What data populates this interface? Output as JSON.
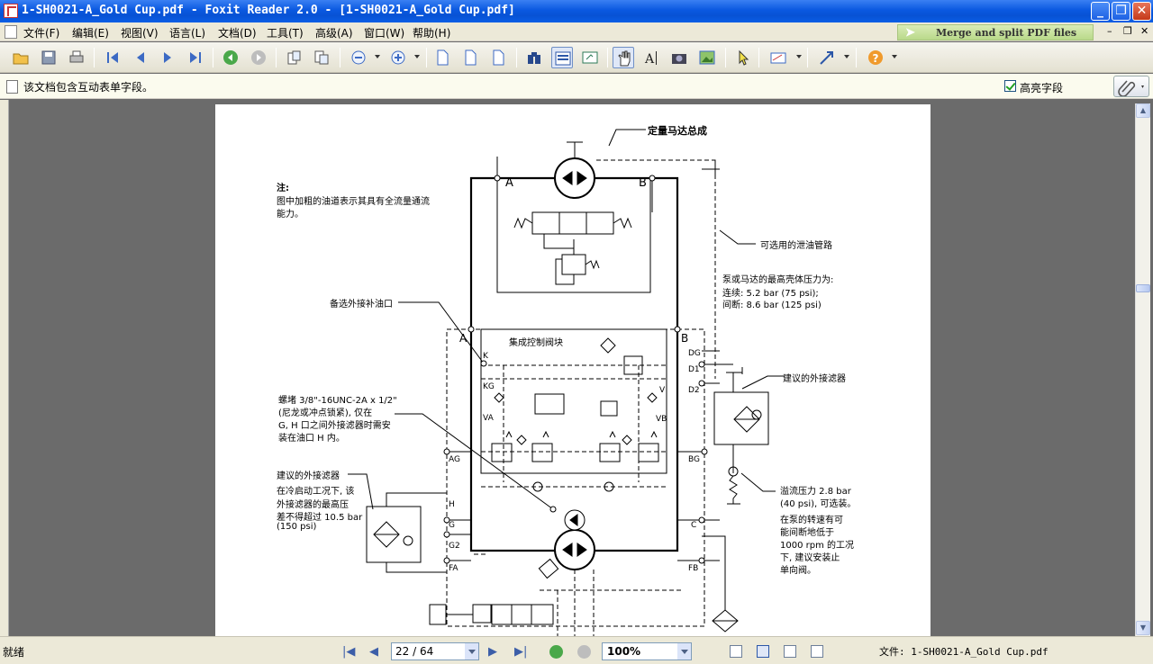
{
  "window": {
    "title": "1-SH0021-A_Gold Cup.pdf - Foxit Reader 2.0 - [1-SH0021-A_Gold Cup.pdf]"
  },
  "menu": [
    "文件(F)",
    "编辑(E)",
    "视图(V)",
    "语言(L)",
    "文档(D)",
    "工具(T)",
    "高级(A)",
    "窗口(W)",
    "帮助(H)"
  ],
  "merge_banner": "Merge and split PDF files",
  "infobar": {
    "message": "该文档包含互动表单字段。",
    "highlight_label": "高亮字段"
  },
  "document": {
    "title_top": "定量马达总成",
    "note_title": "注:",
    "note_body_1": "图中加粗的油道表示其具有全流量通流",
    "note_body_2": "能力。",
    "drain_label": "可选用的泄油管路",
    "case_pressure_1": "泵或马达的最高壳体压力为:",
    "case_pressure_2": "连续: 5.2 bar (75 psi);",
    "case_pressure_3": "间断: 8.6 bar (125 psi)",
    "aux_port": "备选外接补油口",
    "manifold": "集成控制阀块",
    "filter_right": "建议的外接滤器",
    "plug_1": "螺堵 3/8\"-16UNC-2A x 1/2\"",
    "plug_2": "(尼龙或冲点锁紧), 仅在",
    "plug_3": "G, H 口之间外接滤器时需安",
    "plug_4": "装在油口 H 内。",
    "filter_left": "建议的外接滤器",
    "filter_left_1": "在冷启动工况下, 该",
    "filter_left_2": "外接滤器的最高压",
    "filter_left_3": "差不得超过 10.5 bar",
    "filter_left_4": "(150 psi)",
    "relief_1": "溢流压力 2.8 bar",
    "relief_2": "(40 psi), 可选装。",
    "relief_3": "在泵的转速有可",
    "relief_4": "能间断地低于",
    "relief_5": "1000 rpm 的工况",
    "relief_6": "下, 建议安装止",
    "relief_7": "单向阀。",
    "ports": {
      "A": "A",
      "B": "B",
      "A2": "A",
      "B2": "B",
      "K": "K",
      "KG": "KG",
      "VA": "VA",
      "V": "V",
      "VB": "VB",
      "DG": "DG",
      "D1": "D1",
      "D2": "D2",
      "AG": "AG",
      "BG": "BG",
      "H": "H",
      "G": "G",
      "G2": "G2",
      "C": "C",
      "FA": "FA",
      "FB": "FB"
    }
  },
  "status": {
    "ready": "就绪",
    "page_indicator": "22 / 64",
    "zoom": "100%",
    "file": "文件: 1-SH0021-A_Gold Cup.pdf"
  }
}
